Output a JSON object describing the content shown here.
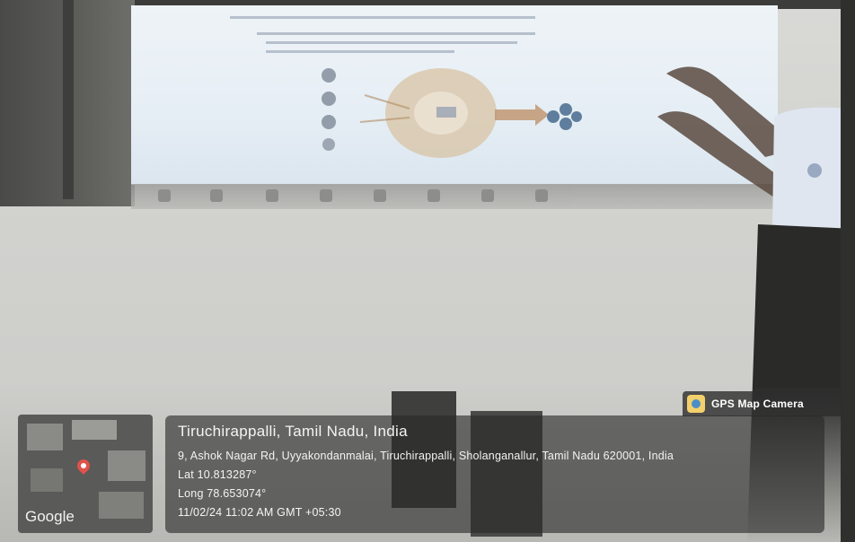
{
  "overlay": {
    "badge": "GPS Map Camera",
    "map_attribution": "Google",
    "city": "Tiruchirappalli, Tamil Nadu, India",
    "address": "9, Ashok Nagar Rd, Uyyakondanmalai, Tiruchirappalli, Sholanganallur, Tamil Nadu 620001, India",
    "lat": "Lat 10.813287°",
    "long": "Long 78.653074°",
    "datetime": "11/02/24 11:02 AM GMT +05:30"
  },
  "icons": {
    "badge": "camera-map-icon",
    "pin": "map-pin-icon"
  },
  "colors": {
    "panel_bg": "#3a3a3a",
    "pin": "#e0524a",
    "badge_icon": "#f3d06b"
  }
}
